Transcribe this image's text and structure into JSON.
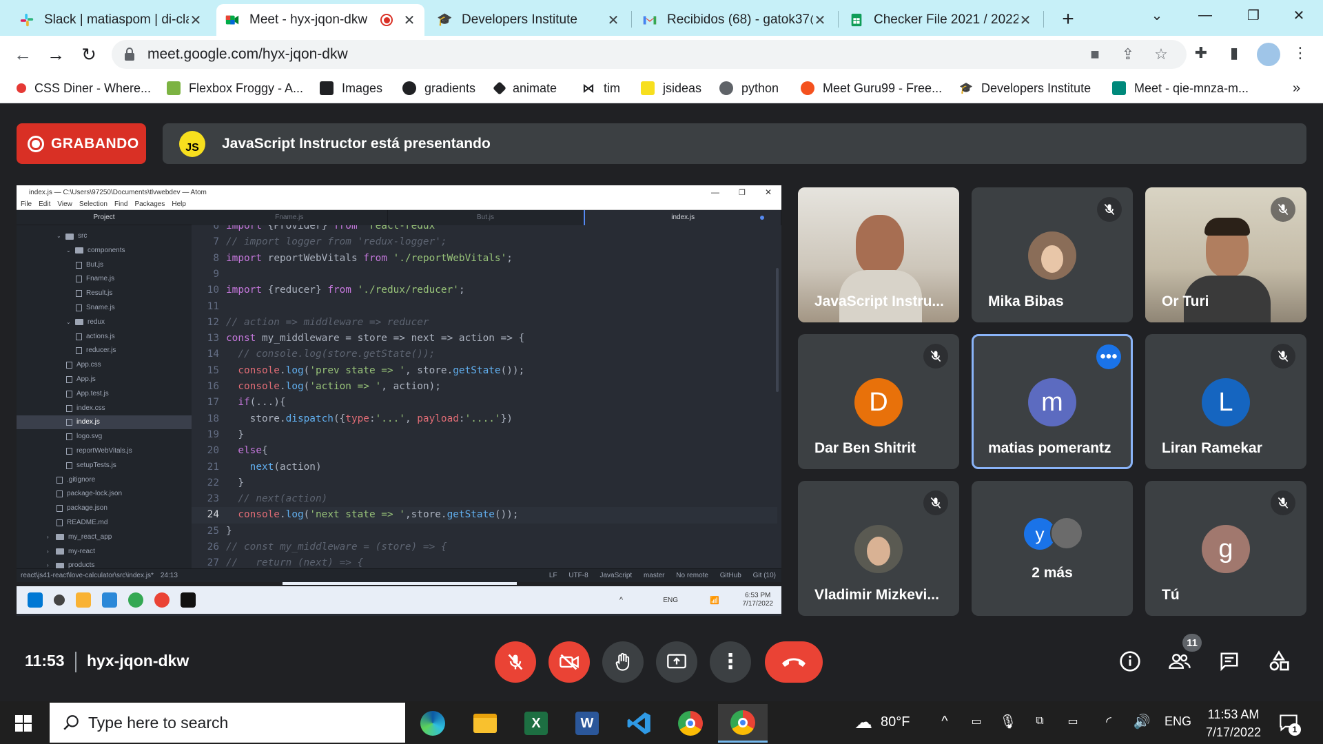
{
  "browser": {
    "tabs": [
      {
        "title": "Slack | matiaspom | di-cla",
        "icon": "slack-icon"
      },
      {
        "title": "Meet - hyx-jqon-dkw",
        "icon": "meet-icon"
      },
      {
        "title": "Developers Institute",
        "icon": "graduation-cap-icon"
      },
      {
        "title": "Recibidos (68) - gatok37@",
        "icon": "gmail-icon"
      },
      {
        "title": "Checker File 2021 / 2022",
        "icon": "sheets-icon"
      }
    ],
    "url": "meet.google.com/hyx-jqon-dkw",
    "bookmarks": [
      {
        "label": "CSS Diner - Where...",
        "color": "#e53935"
      },
      {
        "label": "Flexbox Froggy - A...",
        "color": "#7cb342"
      },
      {
        "label": "Images",
        "color": "#202124"
      },
      {
        "label": "gradients",
        "color": "#202124"
      },
      {
        "label": "animate",
        "color": "#202124"
      },
      {
        "label": "tim",
        "color": "#202124"
      },
      {
        "label": "jsideas",
        "color": "#f7df1e"
      },
      {
        "label": "python",
        "color": "#5f6368"
      },
      {
        "label": "Meet Guru99 - Free...",
        "color": "#f4511e"
      },
      {
        "label": "Developers Institute",
        "color": "#202124"
      },
      {
        "label": "Meet - qie-mnza-m...",
        "color": "#00897b"
      }
    ]
  },
  "meet": {
    "recording_label": "GRABANDO",
    "presenting_avatar": "JS",
    "presenting_text": "JavaScript Instructor está presentando",
    "meeting_time": "11:53",
    "meeting_code": "hyx-jqon-dkw",
    "participants_count": "11",
    "participants": [
      {
        "name": "JavaScript Instru...",
        "type": "video"
      },
      {
        "name": "Mika Bibas",
        "type": "photo"
      },
      {
        "name": "Or Turi",
        "type": "video"
      },
      {
        "name": "Dar Ben Shitrit",
        "initial": "D",
        "color": "#e8710a"
      },
      {
        "name": "matias pomerantz",
        "initial": "m",
        "color": "#5c6bc0"
      },
      {
        "name": "Liran Ramekar",
        "initial": "L",
        "color": "#1565c0"
      },
      {
        "name": "Vladimir Mizkevi...",
        "type": "photo"
      },
      {
        "name": "2 más",
        "initial": "y",
        "color": "#1a73e8"
      },
      {
        "name": "Tú",
        "initial": "g",
        "color": "#a1786e"
      }
    ]
  },
  "shared_screen": {
    "window_title": "index.js — C:\\Users\\97250\\Documents\\tlvwebdev — Atom",
    "menu": [
      "File",
      "Edit",
      "View",
      "Selection",
      "Find",
      "Packages",
      "Help"
    ],
    "project_label": "Project",
    "tabs": [
      "Fname.js",
      "But.js",
      "index.js"
    ],
    "tree": [
      {
        "name": "src",
        "level": 1,
        "kind": "folder",
        "open": true
      },
      {
        "name": "components",
        "level": 2,
        "kind": "folder",
        "open": true
      },
      {
        "name": "But.js",
        "level": 3,
        "kind": "file"
      },
      {
        "name": "Fname.js",
        "level": 3,
        "kind": "file"
      },
      {
        "name": "Result.js",
        "level": 3,
        "kind": "file"
      },
      {
        "name": "Sname.js",
        "level": 3,
        "kind": "file"
      },
      {
        "name": "redux",
        "level": 2,
        "kind": "folder",
        "open": true
      },
      {
        "name": "actions.js",
        "level": 3,
        "kind": "file"
      },
      {
        "name": "reducer.js",
        "level": 3,
        "kind": "file"
      },
      {
        "name": "App.css",
        "level": 2,
        "kind": "file"
      },
      {
        "name": "App.js",
        "level": 2,
        "kind": "file"
      },
      {
        "name": "App.test.js",
        "level": 2,
        "kind": "file"
      },
      {
        "name": "index.css",
        "level": 2,
        "kind": "file"
      },
      {
        "name": "index.js",
        "level": 2,
        "kind": "file",
        "selected": true
      },
      {
        "name": "logo.svg",
        "level": 2,
        "kind": "file"
      },
      {
        "name": "reportWebVitals.js",
        "level": 2,
        "kind": "file"
      },
      {
        "name": "setupTests.js",
        "level": 2,
        "kind": "file"
      },
      {
        "name": ".gitignore",
        "level": 1,
        "kind": "file"
      },
      {
        "name": "package-lock.json",
        "level": 1,
        "kind": "file"
      },
      {
        "name": "package.json",
        "level": 1,
        "kind": "file"
      },
      {
        "name": "README.md",
        "level": 1,
        "kind": "file"
      },
      {
        "name": "my_react_app",
        "level": 0,
        "kind": "folder",
        "open": false
      },
      {
        "name": "my-react",
        "level": 0,
        "kind": "folder",
        "open": false
      },
      {
        "name": "products",
        "level": 0,
        "kind": "folder",
        "open": false
      }
    ],
    "code_lines": [
      {
        "n": "6",
        "html": "<span class='kw'>import</span> <span class='pl'>{Provider}</span> <span class='kw'>from</span> <span class='st'>'react-redux'</span>"
      },
      {
        "n": "7",
        "html": "<span class='cm'>// import logger from 'redux-logger';</span>"
      },
      {
        "n": "8",
        "html": "<span class='kw'>import</span> <span class='pl'>reportWebVitals</span> <span class='kw'>from</span> <span class='st'>'./reportWebVitals'</span><span class='pl'>;</span>"
      },
      {
        "n": "9",
        "html": ""
      },
      {
        "n": "10",
        "html": "<span class='kw'>import</span> <span class='pl'>{reducer}</span> <span class='kw'>from</span> <span class='st'>'./redux/reducer'</span><span class='pl'>;</span>"
      },
      {
        "n": "11",
        "html": ""
      },
      {
        "n": "12",
        "html": "<span class='cm'>// action => middleware => reducer</span>"
      },
      {
        "n": "13",
        "html": "<span class='kw'>const</span> <span class='pl'>my_middleware = store =&gt; next =&gt; action =&gt; {</span>"
      },
      {
        "n": "14",
        "html": "  <span class='cm'>// console.log(store.getState());</span>"
      },
      {
        "n": "15",
        "html": "  <span class='pr'>console</span><span class='pl'>.</span><span class='fn'>log</span><span class='pl'>(</span><span class='st'>'prev state =&gt; '</span><span class='pl'>, store.</span><span class='fn'>getState</span><span class='pl'>());</span>"
      },
      {
        "n": "16",
        "html": "  <span class='pr'>console</span><span class='pl'>.</span><span class='fn'>log</span><span class='pl'>(</span><span class='st'>'action =&gt; '</span><span class='pl'>, action);</span>"
      },
      {
        "n": "17",
        "html": "  <span class='kw'>if</span><span class='pl'>(...){</span>"
      },
      {
        "n": "18",
        "html": "    <span class='pl'>store.</span><span class='fn'>dispatch</span><span class='pl'>({</span><span class='pr'>type</span><span class='pl'>:</span><span class='st'>'...'</span><span class='pl'>, </span><span class='pr'>payload</span><span class='pl'>:</span><span class='st'>'....'</span><span class='pl'>})</span>"
      },
      {
        "n": "19",
        "html": "  <span class='pl'>}</span>"
      },
      {
        "n": "20",
        "html": "  <span class='kw'>else</span><span class='pl'>{</span>"
      },
      {
        "n": "21",
        "html": "    <span class='fn'>next</span><span class='pl'>(action)</span>"
      },
      {
        "n": "22",
        "html": "  <span class='pl'>}</span>"
      },
      {
        "n": "23",
        "html": "  <span class='cm'>// next(action)</span>"
      },
      {
        "n": "24",
        "html": "  <span class='pr'>console</span><span class='pl'>.</span><span class='fn'>log</span><span class='pl'>(</span><span class='st'>'next state =&gt; '</span><span class='pl'>,store.</span><span class='fn'>getState</span><span class='pl'>());</span>",
        "current": true
      },
      {
        "n": "25",
        "html": "<span class='pl'>}</span>"
      },
      {
        "n": "26",
        "html": "<span class='cm'>// const my_middleware = (store) =&gt; {</span>"
      },
      {
        "n": "27",
        "html": "<span class='cm'>//   return (next) =&gt; {</span>"
      }
    ],
    "status_path": "react\\js41-react\\love-calculator\\src\\index.js*",
    "status_pos": "24:13",
    "status_right": [
      "LF",
      "UTF-8",
      "JavaScript",
      "master",
      "No remote",
      "GitHub",
      "Git (10)"
    ],
    "inner_taskbar": {
      "lang": "ENG",
      "time": "6:53 PM",
      "date": "7/17/2022"
    }
  },
  "taskbar": {
    "search_placeholder": "Type here to search",
    "weather": "80°F",
    "lang": "ENG",
    "time": "11:53 AM",
    "date": "7/17/2022",
    "notifications": "1"
  }
}
